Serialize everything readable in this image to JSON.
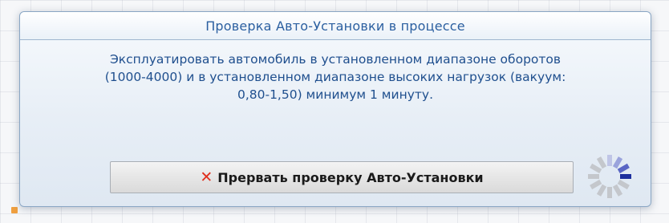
{
  "dialog": {
    "title": "Проверка Авто-Установки в процессе",
    "message_lines": [
      "Эксплуатировать автомобиль в установленном диапазоне оборотов",
      "(1000-4000) и в установленном диапазоне высоких нагрузок (вакуум:",
      "0,80-1,50) минимум 1 минуту."
    ],
    "cancel_button": {
      "icon": "close-icon",
      "icon_glyph": "✕",
      "label": "Прервать проверку Авто-Установки"
    },
    "spinner_icon": "loading-spinner-icon"
  },
  "colors": {
    "title_text": "#2b5fa0",
    "message_text": "#1f4f8e",
    "cancel_icon": "#e0301e",
    "spinner_active": "#1d2f9e",
    "spinner_inactive": "#c4c7cc"
  }
}
